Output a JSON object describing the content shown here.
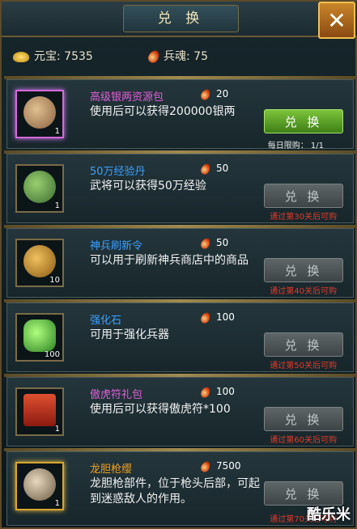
{
  "window": {
    "title": "兑 换",
    "close_label": "✕"
  },
  "currency": {
    "yuanbao_label": "元宝",
    "yuanbao_value": "7535",
    "soul_label": "兵魂",
    "soul_value": "75"
  },
  "items": [
    {
      "name": "高级银两资源包",
      "name_color": "#e060d8",
      "desc": "使用后可以获得200000银两",
      "cost": "20",
      "qty": "1",
      "button": "兑 换",
      "button_state": "active",
      "limit": "每日限购：   1/1",
      "condition": "",
      "icon": "money-bag-icon",
      "art_color": "#b08a60",
      "frame": "hl"
    },
    {
      "name": "50万经验丹",
      "name_color": "#3aa0ff",
      "desc": "武将可以获得50万经验",
      "cost": "50",
      "qty": "1",
      "button": "兑 换",
      "button_state": "disabled",
      "limit": "",
      "condition": "通过第30关后可购",
      "icon": "exp-pill-icon",
      "art_color": "#5a8a40",
      "frame": ""
    },
    {
      "name": "神兵刷新令",
      "name_color": "#3aa0ff",
      "desc": "可以用于刷新神兵商店中的商品",
      "cost": "50",
      "qty": "10",
      "button": "兑 换",
      "button_state": "disabled",
      "limit": "",
      "condition": "通过第40关后可购",
      "icon": "refresh-token-icon",
      "art_color": "#a07a30",
      "frame": ""
    },
    {
      "name": "强化石",
      "name_color": "#3aa0ff",
      "desc": "可用于强化兵器",
      "cost": "100",
      "qty": "100",
      "button": "兑 换",
      "button_state": "disabled",
      "limit": "",
      "condition": "通过第50关后可购",
      "icon": "enhance-stone-icon",
      "art_color": "#4ad040",
      "frame": ""
    },
    {
      "name": "傲虎符礼包",
      "name_color": "#e060d8",
      "desc": "使用后可以获得傲虎符*100",
      "cost": "100",
      "qty": "1",
      "button": "兑 换",
      "button_state": "disabled",
      "limit": "",
      "condition": "通过第60关后可购",
      "icon": "gift-box-icon",
      "art_color": "#d04020",
      "frame": ""
    },
    {
      "name": "龙胆枪缨",
      "name_color": "#f0a020",
      "desc": "龙胆枪部件，位于枪头后部，可起到迷惑敌人的作用。",
      "cost": "7500",
      "qty": "1",
      "button": "兑 换",
      "button_state": "disabled",
      "limit": "",
      "condition": "通过第70关后可购",
      "icon": "spear-tassel-icon",
      "art_color": "#c8b090",
      "frame": "gold"
    }
  ],
  "watermark": "酷乐米"
}
